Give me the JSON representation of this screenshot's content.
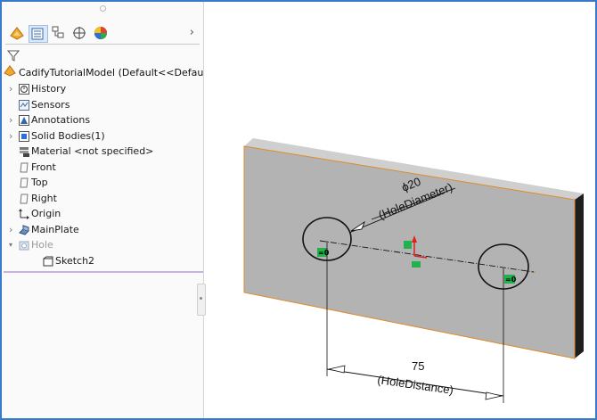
{
  "feature_manager": {
    "tabs": [
      "feature-manager-tab",
      "property-manager-tab",
      "configuration-manager-tab",
      "dimxpert-tab",
      "display-manager-tab"
    ],
    "root_label": "CadifyTutorialModel  (Default<<Defau",
    "items": [
      {
        "label": "History",
        "icon": "history-icon",
        "expandable": true
      },
      {
        "label": "Sensors",
        "icon": "sensors-icon",
        "expandable": false
      },
      {
        "label": "Annotations",
        "icon": "annotations-icon",
        "expandable": true
      },
      {
        "label": "Solid Bodies(1)",
        "icon": "solid-bodies-icon",
        "expandable": true
      },
      {
        "label": "Material <not specified>",
        "icon": "material-icon",
        "expandable": false
      },
      {
        "label": "Front",
        "icon": "plane-icon",
        "expandable": false
      },
      {
        "label": "Top",
        "icon": "plane-icon",
        "expandable": false
      },
      {
        "label": "Right",
        "icon": "plane-icon",
        "expandable": false
      },
      {
        "label": "Origin",
        "icon": "origin-icon",
        "expandable": false
      },
      {
        "label": "MainPlate",
        "icon": "extrude-icon",
        "expandable": true
      },
      {
        "label": "Hole",
        "icon": "cut-icon",
        "expandable": true,
        "expanded": true,
        "greyed": true
      },
      {
        "label": "Sketch2",
        "icon": "sketch-icon",
        "expandable": false,
        "child": true
      }
    ]
  },
  "model": {
    "diameter_symbol": "ϕ20",
    "diameter_name": "(HoleDiameter)",
    "distance_value": "75",
    "distance_name": "(HoleDistance)",
    "relation_label": "=0",
    "colors": {
      "plate_face": "#b3b3b3",
      "plate_top": "#cfcfcf",
      "plate_side": "#1e1e1e",
      "edge": "#e08a2a",
      "sketch": "#111111",
      "relation_bg": "#22b14c"
    }
  }
}
